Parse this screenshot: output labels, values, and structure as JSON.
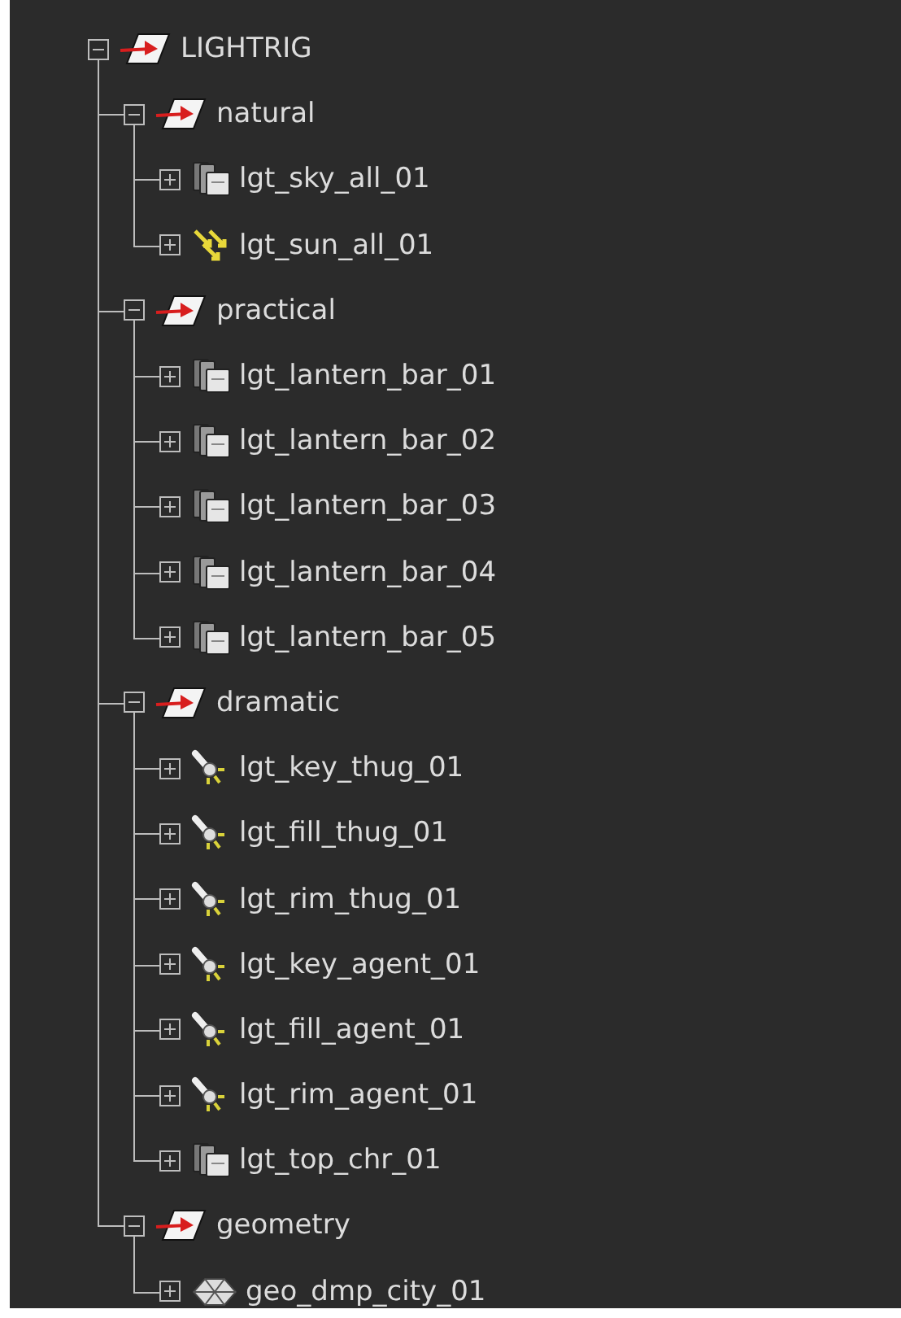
{
  "tree": [
    {
      "label": "LIGHTRIG",
      "kind": "group",
      "expanded": true,
      "children": [
        {
          "label": "natural",
          "kind": "group",
          "expanded": true,
          "children": [
            {
              "label": "lgt_sky_all_01",
              "kind": "sky",
              "expanded": false
            },
            {
              "label": "lgt_sun_all_01",
              "kind": "sun",
              "expanded": false
            }
          ]
        },
        {
          "label": "practical",
          "kind": "group",
          "expanded": true,
          "children": [
            {
              "label": "lgt_lantern_bar_01",
              "kind": "sky",
              "expanded": false
            },
            {
              "label": "lgt_lantern_bar_02",
              "kind": "sky",
              "expanded": false
            },
            {
              "label": "lgt_lantern_bar_03",
              "kind": "sky",
              "expanded": false
            },
            {
              "label": "lgt_lantern_bar_04",
              "kind": "sky",
              "expanded": false
            },
            {
              "label": "lgt_lantern_bar_05",
              "kind": "sky",
              "expanded": false
            }
          ]
        },
        {
          "label": "dramatic",
          "kind": "group",
          "expanded": true,
          "children": [
            {
              "label": "lgt_key_thug_01",
              "kind": "spot",
              "expanded": false
            },
            {
              "label": "lgt_fill_thug_01",
              "kind": "spot",
              "expanded": false
            },
            {
              "label": "lgt_rim_thug_01",
              "kind": "spot",
              "expanded": false
            },
            {
              "label": "lgt_key_agent_01",
              "kind": "spot",
              "expanded": false
            },
            {
              "label": "lgt_fill_agent_01",
              "kind": "spot",
              "expanded": false
            },
            {
              "label": "lgt_rim_agent_01",
              "kind": "spot",
              "expanded": false
            },
            {
              "label": "lgt_top_chr_01",
              "kind": "sky",
              "expanded": false
            }
          ]
        },
        {
          "label": "geometry",
          "kind": "group",
          "expanded": true,
          "children": [
            {
              "label": "geo_dmp_city_01",
              "kind": "geo",
              "expanded": false
            }
          ]
        }
      ]
    }
  ]
}
